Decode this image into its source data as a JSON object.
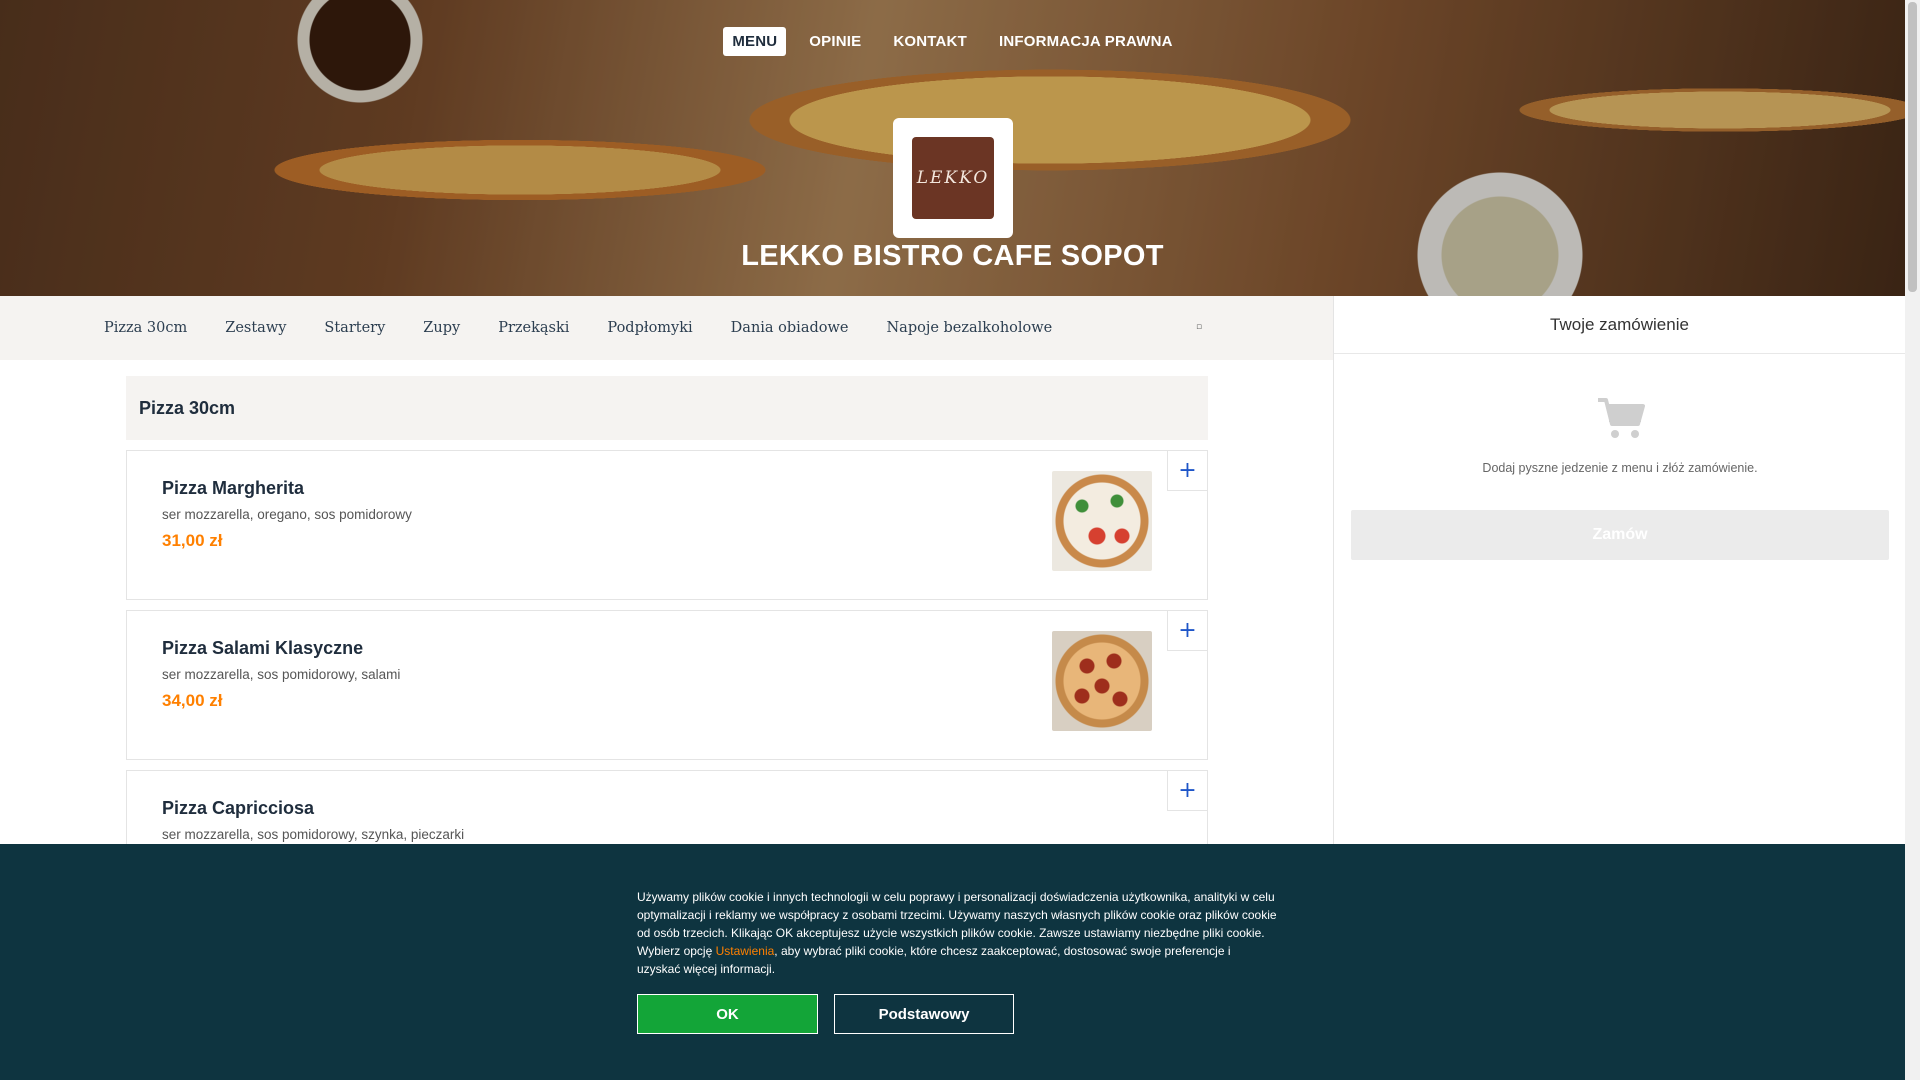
{
  "topnav": {
    "items": [
      {
        "label": "MENU",
        "active": true
      },
      {
        "label": "OPINIE",
        "active": false
      },
      {
        "label": "KONTAKT",
        "active": false
      },
      {
        "label": "INFORMACJA PRAWNA",
        "active": false
      }
    ]
  },
  "restaurant": {
    "name": "LEKKO BISTRO CAFE SOPOT",
    "logo_text": "LEKKO"
  },
  "categories": {
    "items": [
      "Pizza 30cm",
      "Zestawy",
      "Startery",
      "Zupy",
      "Przekąski",
      "Podpłomyki",
      "Dania obiadowe",
      "Napoje bezalkoholowe"
    ],
    "more_icon": "▫"
  },
  "menu": {
    "section_title": "Pizza 30cm",
    "dishes": [
      {
        "name": "Pizza Margherita",
        "description": "ser mozzarella, oregano, sos pomidorowy",
        "price": "31,00 zł"
      },
      {
        "name": "Pizza Salami Klasyczne",
        "description": "ser mozzarella, sos pomidorowy, salami",
        "price": "34,00 zł"
      },
      {
        "name": "Pizza Capricciosa",
        "description": "ser mozzarella, sos pomidorowy, szynka, pieczarki",
        "price": ""
      }
    ],
    "add_label": "+"
  },
  "basket": {
    "title": "Twoje zamówienie",
    "empty_text": "Dodaj pyszne jedzenie z menu i złóż zamówienie.",
    "order_label": "Zamów"
  },
  "cookie": {
    "text_before": "Używamy plików cookie i innych technologii w celu poprawy i personalizacji doświadczenia użytkownika, analityki w celu optymalizacji i reklamy we współpracy z osobami trzecimi. Używamy naszych własnych plików cookie oraz plików cookie od osób trzecich. Klikając OK akceptujesz użycie wszystkich plików cookie. Zawsze ustawiamy niezbędne pliki cookie. Wybierz opcję ",
    "link": "Ustawienia",
    "text_after": ", aby wybrać pliki cookie, które chcesz zaakceptować, dostosować swoje preferencje i uzyskać więcej informacji.",
    "ok_label": "OK",
    "basic_label": "Podstawowy"
  },
  "colors": {
    "accent": "#ff8000",
    "cookie_bg": "#0e3440",
    "ok_green": "#13a538",
    "add_blue": "#1e55c8"
  }
}
